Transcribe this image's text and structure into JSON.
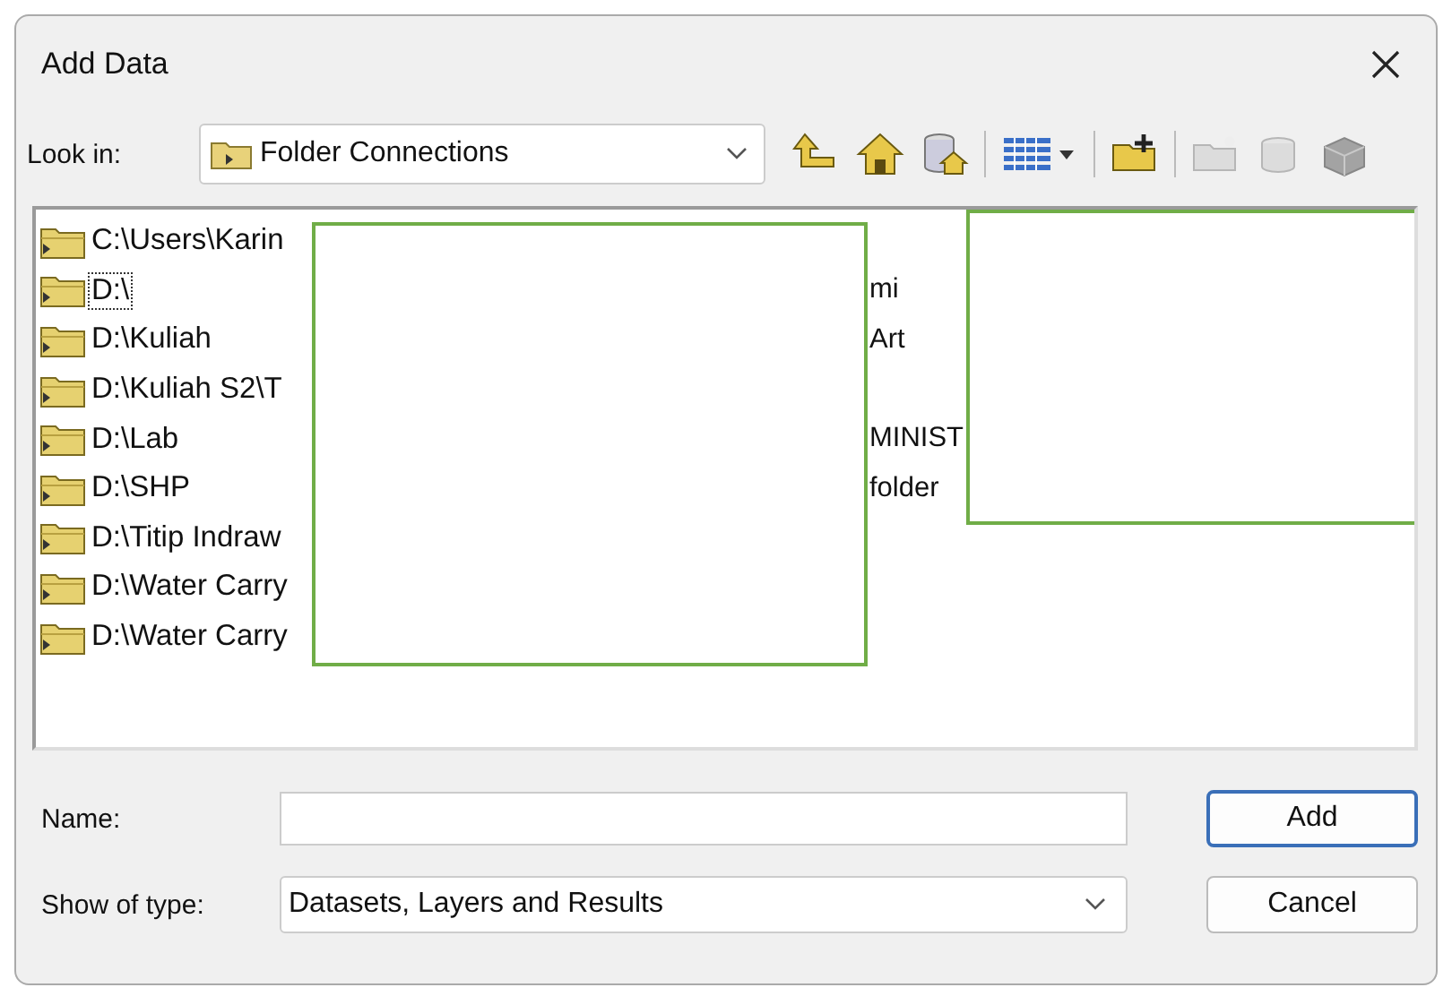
{
  "window": {
    "title": "Add Data"
  },
  "look_in": {
    "label": "Look in:",
    "value": "Folder Connections"
  },
  "toolbar_buttons": [
    {
      "kind": "up",
      "disabled": false
    },
    {
      "kind": "home",
      "disabled": false
    },
    {
      "kind": "database-home",
      "disabled": false
    },
    {
      "kind": "view",
      "disabled": false
    },
    {
      "kind": "connect-folder",
      "disabled": false
    },
    {
      "kind": "new-folder",
      "disabled": true
    },
    {
      "kind": "new-database",
      "disabled": true
    },
    {
      "kind": "new-toolbox",
      "disabled": true
    }
  ],
  "rows": [
    {
      "left": {
        "name": "C:\\Users\\Karin",
        "selected": false
      }
    },
    {
      "left": {
        "name": "D:\\",
        "selected": true
      },
      "right": {
        "name": "mi"
      }
    },
    {
      "left": {
        "name": "D:\\Kuliah",
        "selected": false
      },
      "right": {
        "name": "Art"
      }
    },
    {
      "left": {
        "name": "D:\\Kuliah S2\\T",
        "selected": false
      }
    },
    {
      "left": {
        "name": "D:\\Lab",
        "selected": false
      },
      "right": {
        "name": "MINIST"
      }
    },
    {
      "left": {
        "name": "D:\\SHP",
        "selected": false
      },
      "right": {
        "name": "folder"
      }
    },
    {
      "left": {
        "name": "D:\\Titip Indraw",
        "selected": false
      }
    },
    {
      "left": {
        "name": "D:\\Water Carry",
        "selected": false
      }
    },
    {
      "left": {
        "name": "D:\\Water Carry",
        "selected": false
      }
    }
  ],
  "name_field": {
    "label": "Name:"
  },
  "show_of_type": {
    "label": "Show of type:",
    "value": "Datasets, Layers and Results"
  },
  "buttons": [
    {
      "label": "Add",
      "default": true
    },
    {
      "label": "Cancel",
      "default": false
    }
  ]
}
